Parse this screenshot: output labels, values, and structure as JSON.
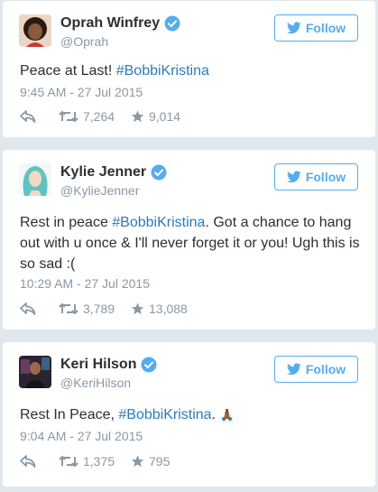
{
  "follow_label": "Follow",
  "colors": {
    "accent": "#55acee",
    "hashtag": "#2b7bb9",
    "muted": "#8899a6",
    "text": "#292f33",
    "background": "#e1e8ed"
  },
  "tweets": [
    {
      "name": "Oprah Winfrey",
      "handle": "@Oprah",
      "verified": true,
      "text_plain": "Peace at Last! ",
      "hashtag": "#BobbiKristina",
      "timestamp": "9:45 AM - 27 Jul 2015",
      "retweets": "7,264",
      "favorites": "9,014"
    },
    {
      "name": "Kylie Jenner",
      "handle": "@KylieJenner",
      "verified": true,
      "text_plain": "Rest in peace ",
      "hashtag": "#BobbiKristina",
      "text_after": ". Got a chance to hang out with u once & I'll never forget it or you! Ugh this is so sad :(",
      "timestamp": "10:29 AM - 27 Jul 2015",
      "retweets": "3,789",
      "favorites": "13,088"
    },
    {
      "name": "Keri Hilson",
      "handle": "@KeriHilson",
      "verified": true,
      "text_plain": "Rest In Peace, ",
      "hashtag": "#BobbiKristina",
      "text_after": ". ",
      "emoji": "🙏🏾",
      "timestamp": "9:04 AM - 27 Jul 2015",
      "retweets": "1,375",
      "favorites": "795"
    }
  ]
}
